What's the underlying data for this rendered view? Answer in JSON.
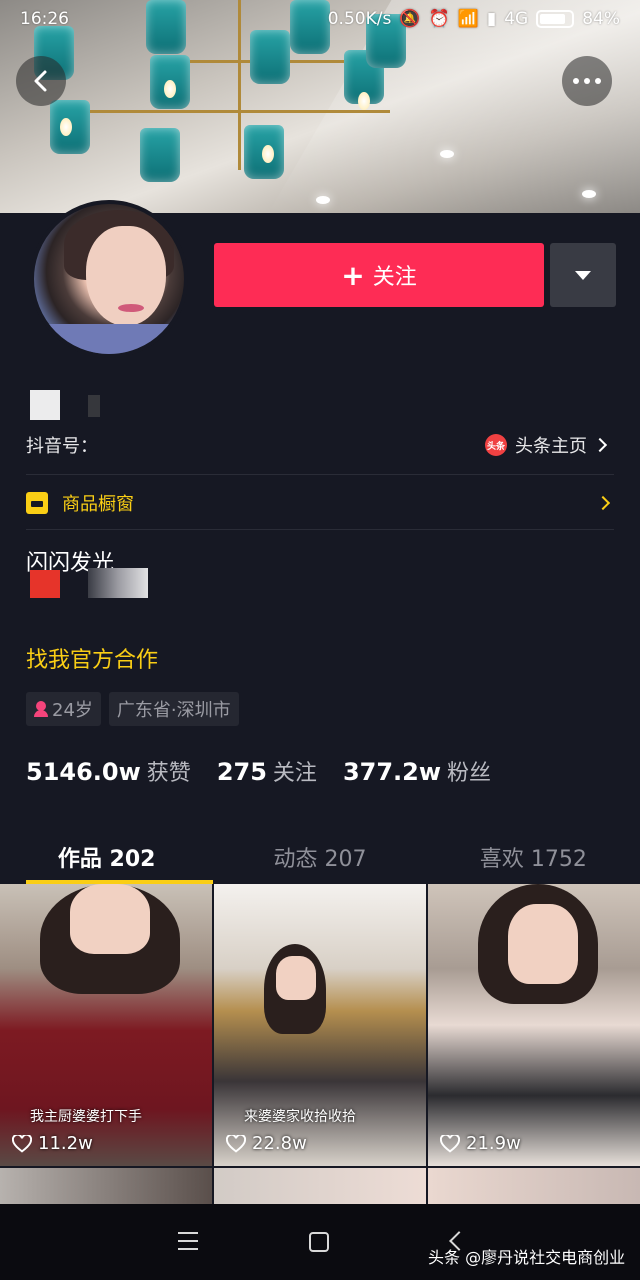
{
  "status_bar": {
    "time": "16:26",
    "network_speed": "0.50K/s",
    "network_type": "4G",
    "battery": "84%"
  },
  "profile": {
    "follow_label": "关注",
    "douyin_id_label": "抖音号：",
    "toutiao_label": "头条主页",
    "toutiao_logo": "头条",
    "shop_label": "商品橱窗",
    "bio": "闪闪发光",
    "cooperation": "找我官方合作",
    "tags": {
      "age": "24岁",
      "location": "广东省·深圳市"
    },
    "stats": {
      "likes_num": "5146.0w",
      "likes_label": "获赞",
      "following_num": "275",
      "following_label": "关注",
      "followers_num": "377.2w",
      "followers_label": "粉丝"
    }
  },
  "tabs": [
    {
      "label": "作品 202"
    },
    {
      "label": "动态 207"
    },
    {
      "label": "喜欢 1752"
    }
  ],
  "videos": [
    {
      "caption": "我主厨婆婆打下手",
      "likes": "11.2w"
    },
    {
      "caption": "来婆婆家收拾收拾",
      "likes": "22.8w"
    },
    {
      "caption": "",
      "likes": "21.9w"
    }
  ],
  "watermark": "头条 @廖丹说社交电商创业",
  "colors": {
    "background": "#161823",
    "follow_red": "#fe2c55",
    "accent_yellow": "#face15"
  }
}
